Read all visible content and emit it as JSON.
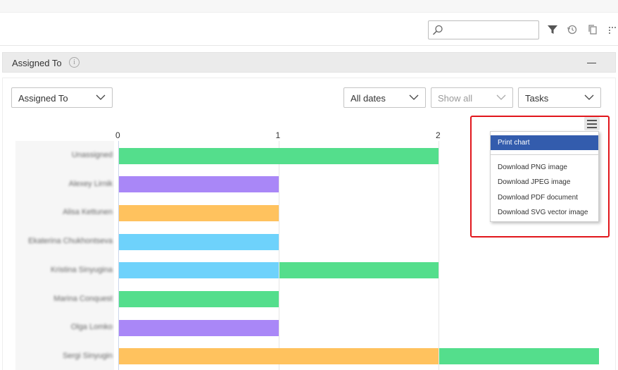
{
  "toolbar": {
    "search_placeholder": "",
    "icons": [
      "search-icon",
      "filter-icon",
      "history-icon",
      "copy-icon",
      "more-icon"
    ]
  },
  "panel": {
    "title": "Assigned To",
    "info_glyph": "i"
  },
  "filters": {
    "group_by": "Assigned To",
    "dates": "All dates",
    "show": "Show all",
    "type": "Tasks"
  },
  "export_menu": {
    "items": [
      {
        "label": "Print chart",
        "active": true
      },
      {
        "label": "Download PNG image",
        "active": false
      },
      {
        "label": "Download JPEG image",
        "active": false
      },
      {
        "label": "Download PDF document",
        "active": false
      },
      {
        "label": "Download SVG vector image",
        "active": false
      }
    ]
  },
  "colors": {
    "green": "#54de8c",
    "purple": "#a987f7",
    "orange": "#ffc25e",
    "blue": "#6ed2fb",
    "menu_active": "#335cad",
    "highlight": "#e1161c"
  },
  "chart_data": {
    "type": "bar",
    "orientation": "horizontal",
    "stacked": true,
    "categories": [
      "Unassigned",
      "Alexey Lirnik",
      "Alisa Kettunen",
      "Ekaterina Chukhontseva",
      "Kristina Sinyugina",
      "Marina Conquest",
      "Olga Lomko",
      "Sergi Sinyugin"
    ],
    "segments": [
      [
        {
          "value": 2,
          "color": "#54de8c"
        }
      ],
      [
        {
          "value": 1,
          "color": "#a987f7"
        }
      ],
      [
        {
          "value": 1,
          "color": "#ffc25e"
        }
      ],
      [
        {
          "value": 1,
          "color": "#6ed2fb"
        }
      ],
      [
        {
          "value": 1,
          "color": "#6ed2fb"
        },
        {
          "value": 1,
          "color": "#54de8c"
        }
      ],
      [
        {
          "value": 1,
          "color": "#54de8c"
        }
      ],
      [
        {
          "value": 1,
          "color": "#a987f7"
        }
      ],
      [
        {
          "value": 2,
          "color": "#ffc25e"
        },
        {
          "value": 1,
          "color": "#54de8c"
        }
      ]
    ],
    "x_ticks": [
      "0",
      "1",
      "2"
    ],
    "xlim": [
      0,
      3
    ],
    "grid": true,
    "legend": "none"
  }
}
